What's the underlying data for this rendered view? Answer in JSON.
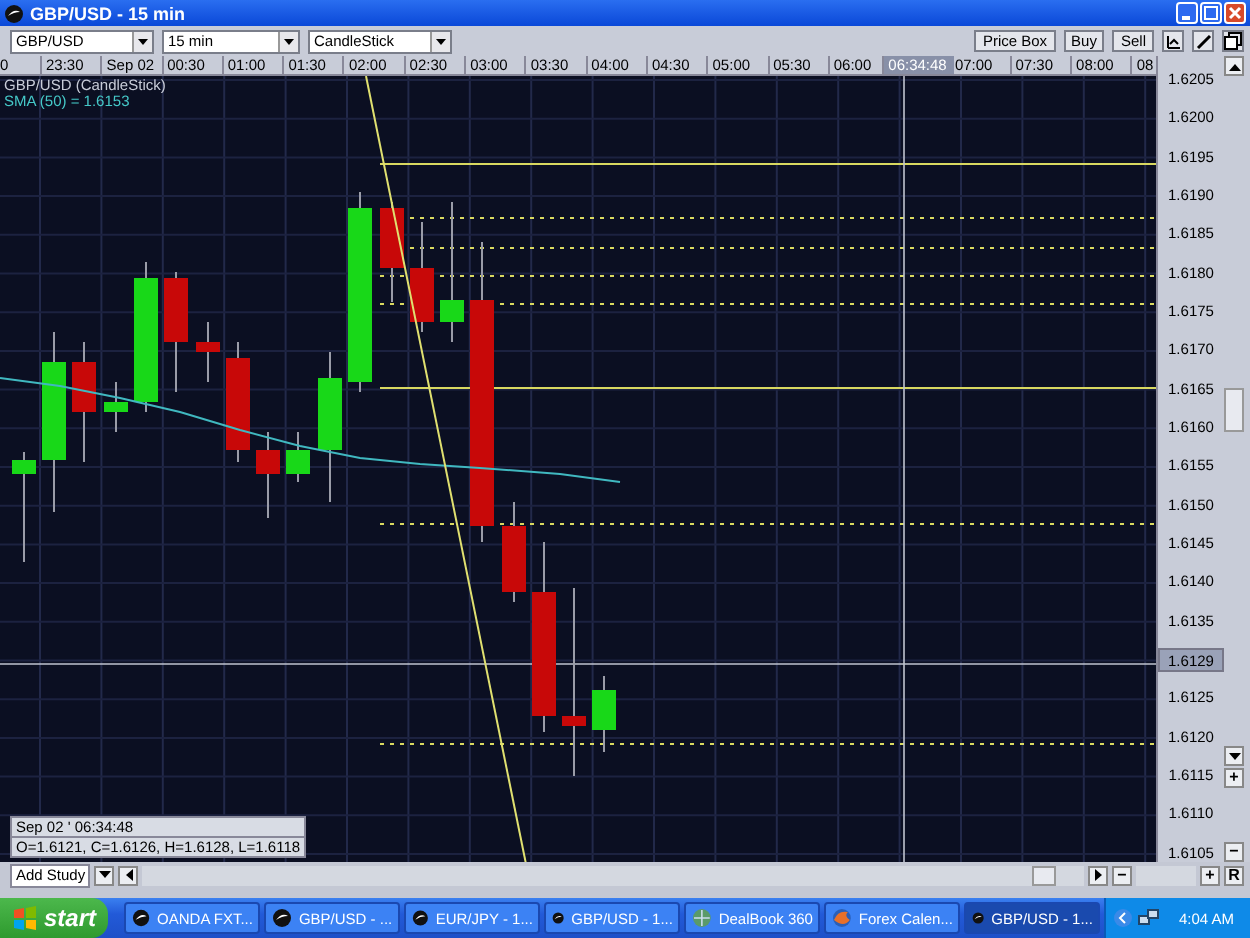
{
  "window": {
    "title": "GBP/USD - 15 min"
  },
  "toolbar": {
    "dropdowns": [
      {
        "value": "GBP/USD"
      },
      {
        "value": "15 min"
      },
      {
        "value": "CandleStick"
      }
    ],
    "buttons": [
      "Price Box",
      "Buy",
      "Sell"
    ]
  },
  "time_axis": {
    "labels": [
      {
        "text": "0",
        "selected": false
      },
      {
        "text": "23:30",
        "selected": false
      },
      {
        "text": "Sep 02",
        "selected": false
      },
      {
        "text": "00:30",
        "selected": false
      },
      {
        "text": "01:00",
        "selected": false
      },
      {
        "text": "01:30",
        "selected": false
      },
      {
        "text": "02:00",
        "selected": false
      },
      {
        "text": "02:30",
        "selected": false
      },
      {
        "text": "03:00",
        "selected": false
      },
      {
        "text": "03:30",
        "selected": false
      },
      {
        "text": "04:00",
        "selected": false
      },
      {
        "text": "04:30",
        "selected": false
      },
      {
        "text": "05:00",
        "selected": false
      },
      {
        "text": "05:30",
        "selected": false
      },
      {
        "text": "06:00",
        "selected": false
      },
      {
        "text": "06:34:48",
        "selected": true
      },
      {
        "text": "07:00",
        "selected": false
      },
      {
        "text": "07:30",
        "selected": false
      },
      {
        "text": "08:00",
        "selected": false
      },
      {
        "text": "08",
        "selected": false
      }
    ]
  },
  "price_axis": {
    "labels": [
      {
        "text": "1.6205",
        "selected": false
      },
      {
        "text": "1.6200",
        "selected": false
      },
      {
        "text": "1.6195",
        "selected": false
      },
      {
        "text": "1.6190",
        "selected": false
      },
      {
        "text": "1.6185",
        "selected": false
      },
      {
        "text": "1.6180",
        "selected": false
      },
      {
        "text": "1.6175",
        "selected": false
      },
      {
        "text": "1.6170",
        "selected": false
      },
      {
        "text": "1.6165",
        "selected": false
      },
      {
        "text": "1.6160",
        "selected": false
      },
      {
        "text": "1.6155",
        "selected": false
      },
      {
        "text": "1.6150",
        "selected": false
      },
      {
        "text": "1.6145",
        "selected": false
      },
      {
        "text": "1.6140",
        "selected": false
      },
      {
        "text": "1.6135",
        "selected": false
      },
      {
        "text": "1.6129",
        "selected": true
      },
      {
        "text": "1.6125",
        "selected": false
      },
      {
        "text": "1.6120",
        "selected": false
      },
      {
        "text": "1.6115",
        "selected": false
      },
      {
        "text": "1.6110",
        "selected": false
      },
      {
        "text": "1.6105",
        "selected": false
      }
    ]
  },
  "legend": [
    {
      "text": "GBP/USD (CandleStick)",
      "kind": "series"
    },
    {
      "text": "SMA (50) = 1.6153",
      "kind": "indicator"
    }
  ],
  "info_box": {
    "time": "Sep 02 ' 06:34:48",
    "values": "O=1.6121, C=1.6126, H=1.6128, L=1.6118"
  },
  "bottom_bar": {
    "study_dropdown": "Add Study",
    "zoom_out": "−",
    "zoom_in": "+",
    "reset": "R"
  },
  "side_bar": {
    "zoom_in": "+",
    "zoom_out": "−"
  },
  "taskbar": {
    "start": "start",
    "items": [
      {
        "label": "OANDA FXT...",
        "kind": "app",
        "selected": false
      },
      {
        "label": "GBP/USD - ...",
        "kind": "app",
        "selected": false
      },
      {
        "label": "EUR/JPY - 1...",
        "kind": "app",
        "selected": false
      },
      {
        "label": "GBP/USD - 1...",
        "kind": "app",
        "selected": false
      },
      {
        "label": "DealBook 360",
        "kind": "dealbook",
        "selected": false
      },
      {
        "label": "Forex Calen...",
        "kind": "browser",
        "selected": false
      },
      {
        "label": "GBP/USD - 1...",
        "kind": "app",
        "selected": true
      }
    ],
    "clock": "4:04 AM"
  }
}
